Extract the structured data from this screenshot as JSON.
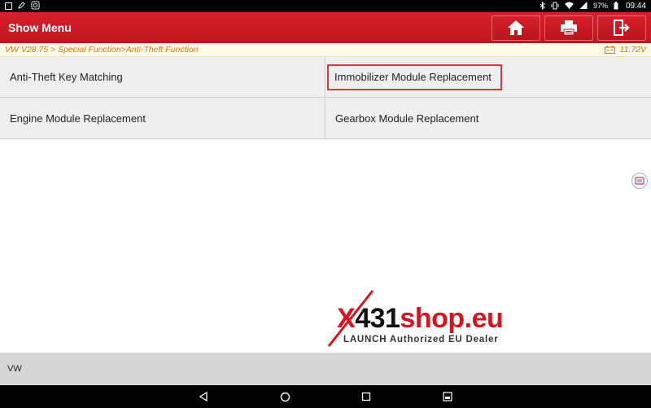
{
  "status_bar": {
    "battery": "97%",
    "time": "09:44",
    "left_icons": [
      "gallery-icon",
      "edit-icon",
      "launch-icon"
    ],
    "right_icons": [
      "bluetooth-icon",
      "vibrate-icon",
      "wifi-icon",
      "signal-icon",
      "battery-icon"
    ]
  },
  "header": {
    "title": "Show Menu",
    "buttons": [
      "home-icon",
      "print-icon",
      "exit-icon"
    ]
  },
  "breadcrumb": {
    "path": "VW V28.75 > Special Function>Anti-Theft Function",
    "voltage": "11.72V"
  },
  "menu": {
    "items": [
      {
        "label": "Anti-Theft Key Matching"
      },
      {
        "label": "Immobilizer Module Replacement"
      },
      {
        "label": "Engine Module Replacement"
      },
      {
        "label": "Gearbox Module Replacement"
      }
    ]
  },
  "watermark": {
    "brand_x": "X",
    "brand_num": "431",
    "brand_shop": "shop.eu",
    "tagline": "LAUNCH Authorized EU Dealer"
  },
  "footer": {
    "label": "VW"
  },
  "nav": {
    "buttons": [
      "back-icon",
      "home-circle-icon",
      "recents-icon",
      "screenshot-icon"
    ]
  },
  "colors": {
    "header_red": "#c8171f",
    "breadcrumb_orange": "#d67a0c",
    "highlight_red": "#d43a3a",
    "grid_bg": "#efefef",
    "footer_bg": "#d7d7d7"
  }
}
